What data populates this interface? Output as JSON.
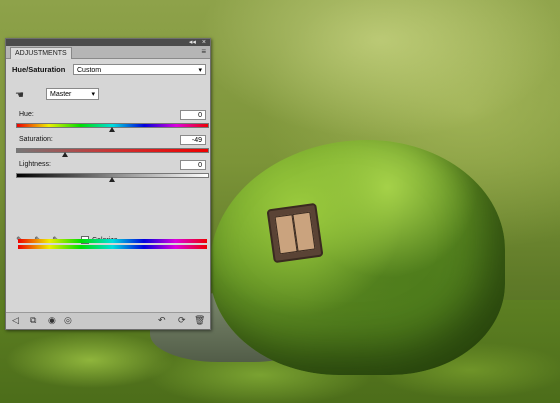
{
  "panel": {
    "tab_label": "ADJUSTMENTS",
    "controls": [
      "◂◂",
      "×"
    ],
    "menu_icon": "panel-menu-icon",
    "title": "Hue/Saturation",
    "preset_value": "Custom",
    "edit_value": "Master",
    "hue_label": "Hue:",
    "hue_value": "0",
    "saturation_label": "Saturation:",
    "saturation_value": "-49",
    "lightness_label": "Lightness:",
    "lightness_value": "0",
    "colorize_label": "Colorize",
    "hue_level": 0.5,
    "saturation_level": 0.255,
    "lightness_level": 0.5
  }
}
